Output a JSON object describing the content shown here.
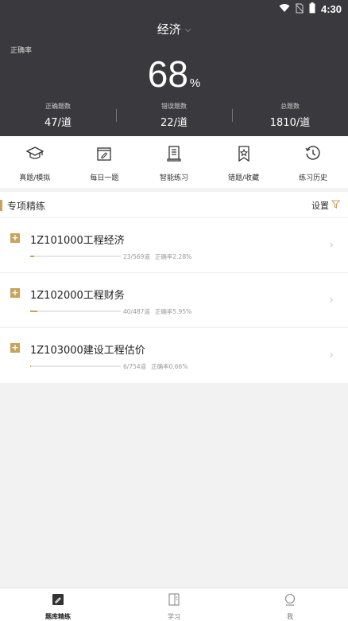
{
  "status_bar": {
    "time": "4:30",
    "icons": [
      "wifi-icon",
      "no-sim-icon",
      "battery-icon"
    ]
  },
  "header": {
    "subject": "经济",
    "accuracy_label": "正确率",
    "accuracy_value": "68",
    "accuracy_unit": "%",
    "stats": [
      {
        "label": "正确题数",
        "value": "47/道"
      },
      {
        "label": "错误题数",
        "value": "22/道"
      },
      {
        "label": "总题数",
        "value": "1810/道"
      }
    ]
  },
  "actions": [
    {
      "label": "真题/模拟",
      "icon": "graduation-cap-icon"
    },
    {
      "label": "每日一题",
      "icon": "calendar-edit-icon"
    },
    {
      "label": "智能练习",
      "icon": "scroll-document-icon"
    },
    {
      "label": "错题/收藏",
      "icon": "bookmark-star-icon"
    },
    {
      "label": "练习历史",
      "icon": "history-clock-icon"
    }
  ],
  "section": {
    "title": "专项精练",
    "settings_label": "设置",
    "items": [
      {
        "name": "1Z101000工程经济",
        "progress_text": "23/569道",
        "accuracy_text": "正确率2.28%",
        "progress": 0.04
      },
      {
        "name": "1Z102000工程财务",
        "progress_text": "40/487道",
        "accuracy_text": "正确率5.95%",
        "progress": 0.082
      },
      {
        "name": "1Z103000建设工程估价",
        "progress_text": "6/754道",
        "accuracy_text": "正确率0.66%",
        "progress": 0.008
      }
    ]
  },
  "bottom_nav": [
    {
      "label": "题库精练",
      "icon": "edit-square-icon",
      "active": true
    },
    {
      "label": "学习",
      "icon": "book-icon",
      "active": false
    },
    {
      "label": "我",
      "icon": "profile-icon",
      "active": false
    }
  ],
  "colors": {
    "header_bg": "#3a3a3e",
    "accent": "#caa25a"
  }
}
